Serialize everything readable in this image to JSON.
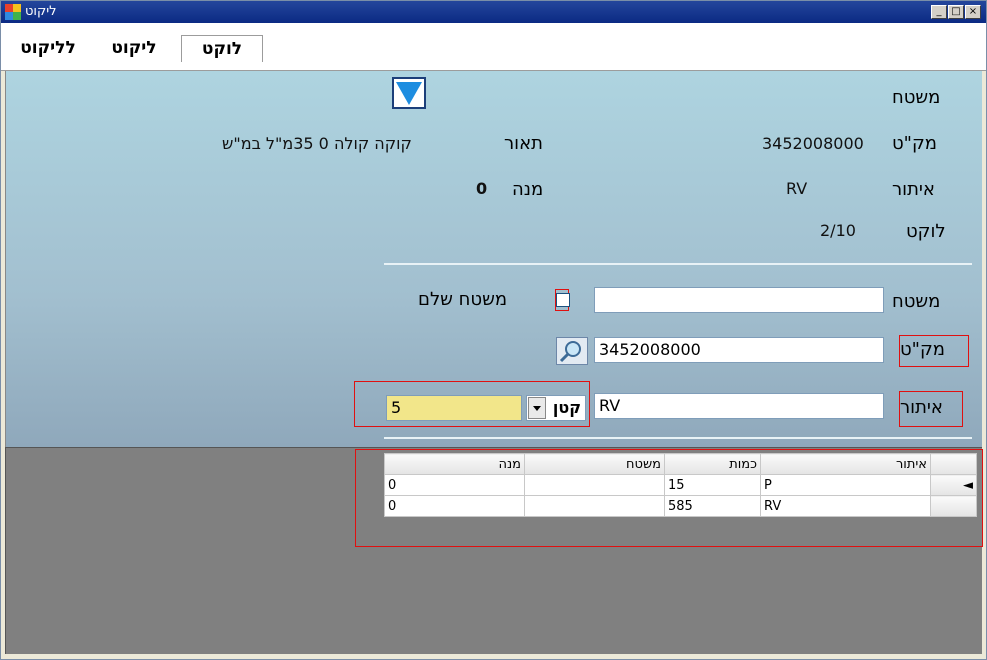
{
  "window": {
    "title": "ליקוט",
    "minimize": "_",
    "maximize": "□",
    "close": "×"
  },
  "tabs": [
    {
      "label": "לליקוט"
    },
    {
      "label": "ליקוט"
    },
    {
      "label": "לוקט"
    }
  ],
  "info": {
    "pallet_label": "משטח",
    "sku_label": "מק\"ט",
    "sku_value": "3452008000",
    "location_label": "איתור",
    "location_value": "RV",
    "picked_label": "לוקט",
    "picked_value": "2/10",
    "desc_label": "תאור",
    "desc_value": "קוקה קולה 0 35מ\"ל במ\"ש",
    "portion_label": "מנה",
    "portion_value": "0"
  },
  "form": {
    "pallet_label": "משטח",
    "pallet_value": "",
    "full_pallet_label": "משטח שלם",
    "sku_label": "מק\"ט",
    "sku_value": "3452008000",
    "location_label": "איתור",
    "location_value": "RV",
    "size_select": "קטן",
    "qty_value": "5"
  },
  "grid": {
    "columns": [
      "איתור",
      "כמות",
      "משטח",
      "מנה"
    ],
    "rows": [
      {
        "location": "P",
        "qty": "15",
        "pallet": "",
        "portion": "0",
        "current": "◄"
      },
      {
        "location": "RV",
        "qty": "585",
        "pallet": "",
        "portion": "0",
        "current": ""
      }
    ]
  },
  "colors": {
    "form_bg_top": "#aed4e0",
    "highlight_input": "#f2e68a",
    "annotation_red": "#e01010"
  }
}
